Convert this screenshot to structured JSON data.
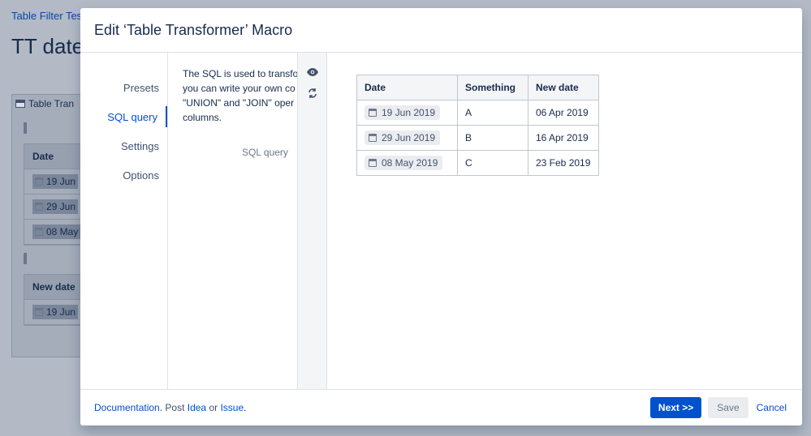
{
  "background": {
    "breadcrumb": "Table Filter Test",
    "title": "TT date",
    "panel_title": "Table Tran",
    "table1": {
      "header": "Date",
      "rows": [
        "19 Jun",
        "29 Jun",
        "08 May"
      ]
    },
    "table2": {
      "header": "New date",
      "rows": [
        "19 Jun"
      ]
    }
  },
  "modal": {
    "title": "Edit ‘Table Transformer’ Macro",
    "nav": [
      {
        "label": "Presets"
      },
      {
        "label": "SQL query"
      },
      {
        "label": "Settings"
      },
      {
        "label": "Options"
      }
    ],
    "description_lines": [
      "The SQL is used to transfo",
      "you can write your own co",
      "\"UNION\" and \"JOIN\" oper",
      "columns."
    ],
    "sql_label": "SQL query",
    "icons": [
      "eye-icon",
      "refresh-icon"
    ],
    "preview": {
      "columns": [
        "Date",
        "Something",
        "New date"
      ],
      "rows": [
        {
          "date": "19 Jun 2019",
          "something": "A",
          "new_date": "06 Apr 2019"
        },
        {
          "date": "29 Jun 2019",
          "something": "B",
          "new_date": "16 Apr 2019"
        },
        {
          "date": "08 May 2019",
          "something": "C",
          "new_date": "23 Feb 2019"
        }
      ]
    },
    "footer": {
      "documentation": "Documentation.",
      "post_text": "Post",
      "idea": "Idea",
      "or_text": "or",
      "issue": "Issue.",
      "next_label": "Next >>",
      "save_label": "Save",
      "cancel_label": "Cancel"
    }
  }
}
